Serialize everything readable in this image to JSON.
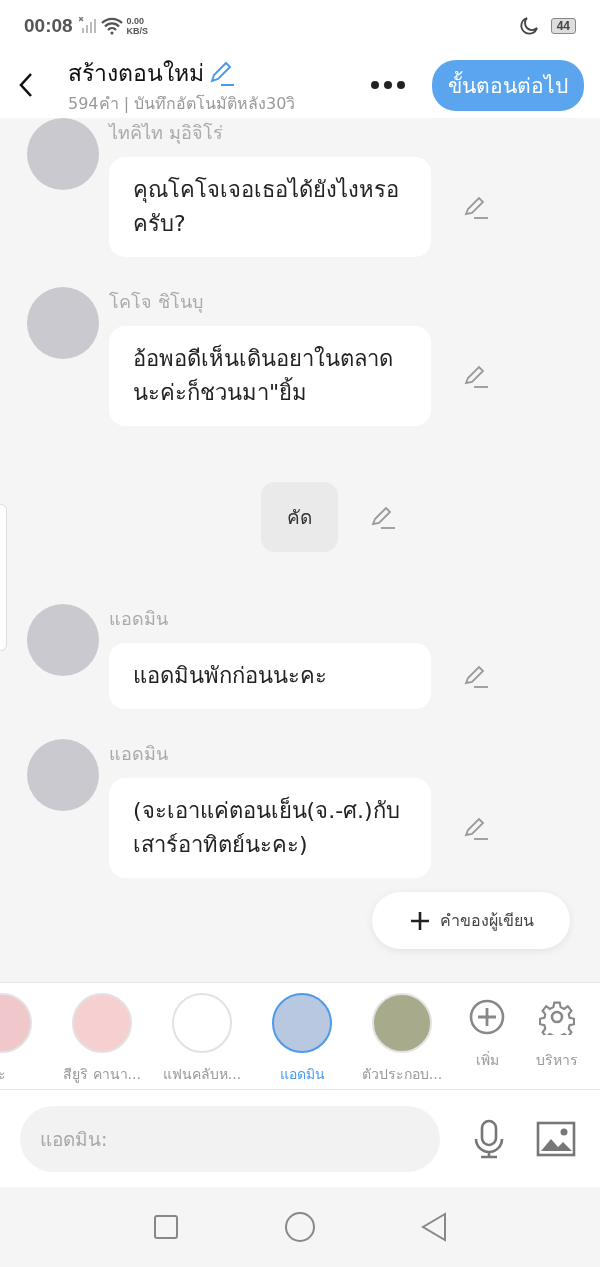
{
  "status_bar": {
    "time": "00:08",
    "net_speed": "0.00",
    "net_unit": "KB/S",
    "battery": "44"
  },
  "header": {
    "title": "สร้างตอนใหม่",
    "subtitle": "594คำ | บันทึกอัตโนมัติหลัง30วิ",
    "next_button": "ขั้นตอนต่อไป"
  },
  "messages": [
    {
      "kind": "message",
      "name": "ไทคิไท มุอิจิโร่",
      "text": "คุณโคโจเจอเธอได้ยังไงหรอครับ?"
    },
    {
      "kind": "message",
      "name": "โคโจ ชิโนบุ",
      "text": "อ้อพอดีเห็นเดินอยาในตลาดนะค่ะก็ชวนมา\"ยิ้ม"
    },
    {
      "kind": "narration",
      "text": "คัด"
    },
    {
      "kind": "message",
      "name": "แอดมิน",
      "text": "แอดมินพักก่อนนะคะ"
    },
    {
      "kind": "message",
      "name": "แอดมิน",
      "text": "(จะเอาแค่ตอนเย็น(จ.-ศ.)กับเสาร์อาทิตย์นะคะ)"
    }
  ],
  "author_note_button": "คำของผู้เขียน",
  "characters": [
    {
      "name": "ะ",
      "selected": false,
      "color": "#f0c8cc"
    },
    {
      "name": "สียูริ คานา...",
      "selected": false,
      "color": "#f6cfd0"
    },
    {
      "name": "แฟนคลับห...",
      "selected": false,
      "color": "#ffffff"
    },
    {
      "name": "แอดมิน",
      "selected": true,
      "color": "#b8c8e0"
    },
    {
      "name": "ตัวประกอบ...",
      "selected": false,
      "color": "#a8aa8c"
    }
  ],
  "actions": [
    {
      "kind": "add",
      "label": "เพิ่ม"
    },
    {
      "kind": "manage",
      "label": "บริหาร"
    }
  ],
  "input": {
    "placeholder": "แอดมิน:"
  }
}
